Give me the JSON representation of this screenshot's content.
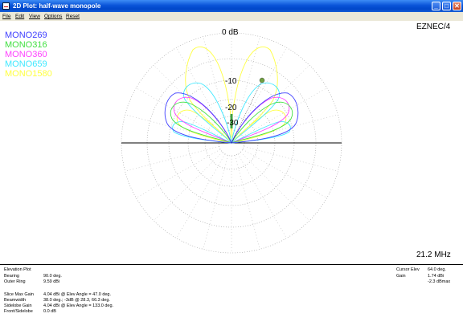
{
  "window": {
    "title": "2D Plot: half-wave monopole"
  },
  "menu": [
    {
      "label": "File"
    },
    {
      "label": "Edit"
    },
    {
      "label": "View"
    },
    {
      "label": "Options"
    },
    {
      "label": "Reset"
    }
  ],
  "plot": {
    "program": "EZNEC/4",
    "frequency": "21.2 MHz",
    "ring_labels": {
      "outer": "0 dB",
      "r10": "-10",
      "r20": "-20",
      "r30": "-30"
    },
    "legend": [
      {
        "name": "MONO269",
        "color": "#4040ff"
      },
      {
        "name": "MONO316",
        "color": "#40e040"
      },
      {
        "name": "MONO360",
        "color": "#ff40ff"
      },
      {
        "name": "MONO659",
        "color": "#40e8ff"
      },
      {
        "name": "MONO1580",
        "color": "#ffff40"
      }
    ]
  },
  "chart_data": {
    "type": "polar-elevation",
    "title": "Elevation Plot",
    "ring_labels": [
      "0 dB",
      "-10",
      "-20",
      "-30"
    ],
    "series": [
      {
        "name": "MONO269",
        "color": "#4040ff"
      },
      {
        "name": "MONO316",
        "color": "#40e040"
      },
      {
        "name": "MONO360",
        "color": "#ff40ff"
      },
      {
        "name": "MONO659",
        "color": "#40e8ff"
      },
      {
        "name": "MONO1580",
        "color": "#ffff40"
      }
    ],
    "cursor": {
      "elevation_deg": 64.0,
      "gain_dbi": 1.74
    }
  },
  "info": {
    "left": [
      {
        "label": "Elevation Plot",
        "value": ""
      },
      {
        "label": "Bearing",
        "value": "90.0 deg."
      },
      {
        "label": "Outer Ring",
        "value": "9.59 dBi"
      },
      {
        "label": "Slice Max Gain",
        "value": "4.04 dBi @ Elev Angle = 47.0 deg."
      },
      {
        "label": "Beamwidth",
        "value": "38.0 deg.; -3dB @ 28.3, 66.3 deg."
      },
      {
        "label": "Sidelobe Gain",
        "value": "4.04 dBi @ Elev Angle = 133.0 deg."
      },
      {
        "label": "Front/Sidelobe",
        "value": "0.0 dB"
      }
    ],
    "right": [
      {
        "label": "Cursor Elev",
        "value": "64.0 deg."
      },
      {
        "label": "Gain",
        "value": "1.74 dBi"
      },
      {
        "label": "",
        "value": "-2.3 dBmax"
      }
    ]
  }
}
